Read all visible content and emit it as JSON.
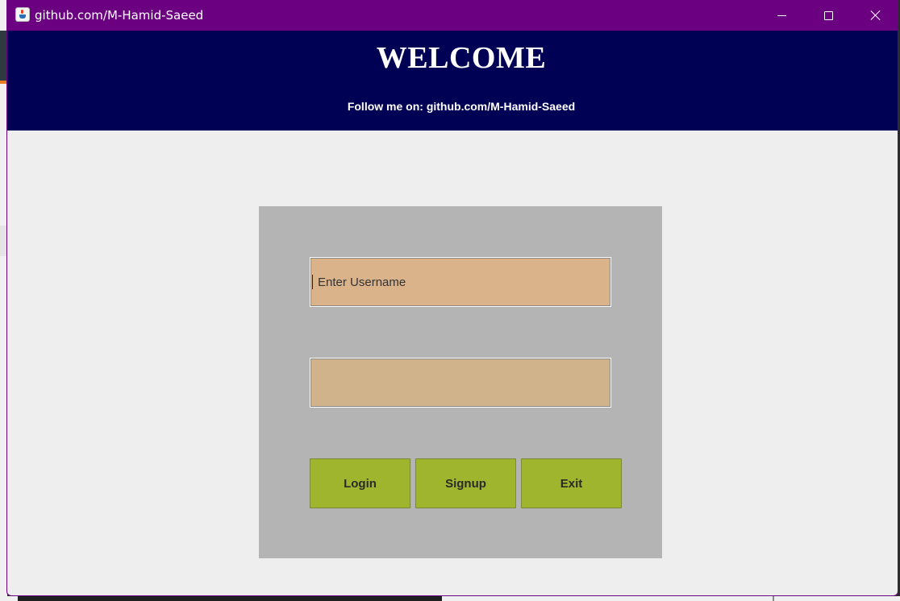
{
  "window": {
    "title": "github.com/M-Hamid-Saeed",
    "icon": "java-app-icon",
    "controls": [
      "minimize-icon",
      "maximize-icon",
      "close-icon"
    ],
    "titlebar_color": "#6b0080"
  },
  "header": {
    "title": "WELCOME",
    "subtitle": "Follow me on: github.com/M-Hamid-Saeed",
    "background": "#000055"
  },
  "form": {
    "username": {
      "value": "",
      "placeholder": "Enter Username"
    },
    "password": {
      "value": "",
      "placeholder": ""
    },
    "buttons": {
      "login": "Login",
      "signup": "Signup",
      "exit": "Exit"
    },
    "button_color": "#a0b52e",
    "panel_color": "#b4b4b4"
  }
}
